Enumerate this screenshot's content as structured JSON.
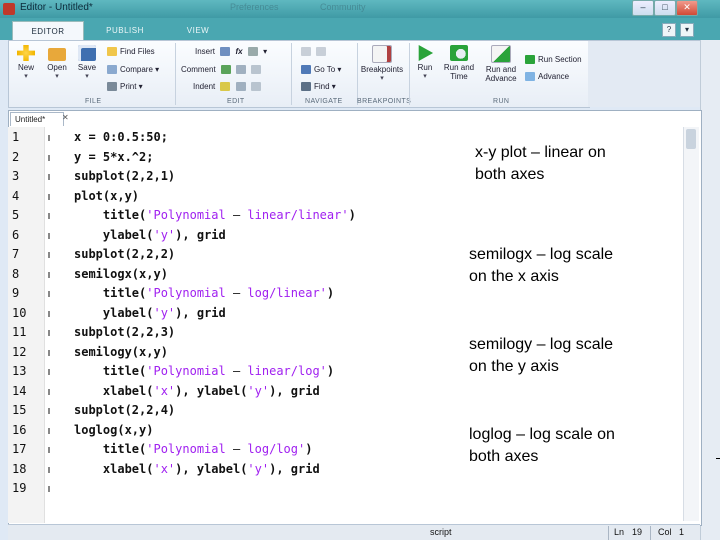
{
  "window": {
    "title": "Editor - Untitled*",
    "ghost_titles": [
      "Preferences",
      "Community"
    ],
    "controls": [
      "–",
      "□",
      "✕"
    ]
  },
  "tabs": [
    {
      "label": "EDITOR",
      "active": true
    },
    {
      "label": "PUBLISH",
      "active": false
    },
    {
      "label": "VIEW",
      "active": false
    }
  ],
  "quick_access": [
    "?",
    "▾"
  ],
  "ribbon": {
    "file": {
      "group_label": "FILE",
      "new": "New",
      "open": "Open",
      "save": "Save",
      "find_files": "Find Files",
      "compare": "Compare",
      "print": "Print"
    },
    "edit": {
      "group_label": "EDIT",
      "insert": "Insert",
      "comment": "Comment",
      "indent": "Indent",
      "fx": "fx"
    },
    "navigate": {
      "group_label": "NAVIGATE",
      "go_to": "Go To",
      "find": "Find"
    },
    "breakpoints": {
      "group_label": "BREAKPOINTS",
      "breakpoints": "Breakpoints"
    },
    "run": {
      "group_label": "RUN",
      "run": "Run",
      "run_and_time": [
        "Run and",
        "Time"
      ],
      "run_and_advance": [
        "Run and",
        "Advance"
      ],
      "run_section": "Run Section",
      "advance": "Advance"
    },
    "colors": {
      "new": "#f2b600",
      "open": "#e8a83a",
      "save": "#3f6fb0",
      "run": "#2aa33a",
      "breakpoints": "#b04040"
    }
  },
  "document_tab": "Untitled*",
  "code_lines": [
    [
      {
        "t": "x = 0:0.5:50;"
      }
    ],
    [
      {
        "t": "y = 5*x.^2;"
      }
    ],
    [
      {
        "t": "subplot(2,2,1)"
      }
    ],
    [
      {
        "t": "plot(x,y)"
      }
    ],
    [
      {
        "t": "    title("
      },
      {
        "t": "'Polynomial",
        "s": 1
      },
      {
        "t": " – ",
        "d": 1
      },
      {
        "t": "linear/linear'",
        "s": 1
      },
      {
        "t": ")"
      }
    ],
    [
      {
        "t": "    ylabel("
      },
      {
        "t": "'y'",
        "s": 1
      },
      {
        "t": "), grid"
      }
    ],
    [
      {
        "t": "subplot(2,2,2)"
      }
    ],
    [
      {
        "t": "semilogx(x,y)"
      }
    ],
    [
      {
        "t": "    title("
      },
      {
        "t": "'Polynomial",
        "s": 1
      },
      {
        "t": " – ",
        "d": 1
      },
      {
        "t": "log/linear'",
        "s": 1
      },
      {
        "t": ")"
      }
    ],
    [
      {
        "t": "    ylabel("
      },
      {
        "t": "'y'",
        "s": 1
      },
      {
        "t": "), grid"
      }
    ],
    [
      {
        "t": "subplot(2,2,3)"
      }
    ],
    [
      {
        "t": "semilogy(x,y)"
      }
    ],
    [
      {
        "t": "    title("
      },
      {
        "t": "'Polynomial",
        "s": 1
      },
      {
        "t": " – ",
        "d": 1
      },
      {
        "t": "linear/log'",
        "s": 1
      },
      {
        "t": ")"
      }
    ],
    [
      {
        "t": "    xlabel("
      },
      {
        "t": "'x'",
        "s": 1
      },
      {
        "t": "), ylabel("
      },
      {
        "t": "'y'",
        "s": 1
      },
      {
        "t": "), grid"
      }
    ],
    [
      {
        "t": "subplot(2,2,4)"
      }
    ],
    [
      {
        "t": "loglog(x,y)"
      }
    ],
    [
      {
        "t": "    title("
      },
      {
        "t": "'Polynomial",
        "s": 1
      },
      {
        "t": " – ",
        "d": 1
      },
      {
        "t": "log/log'",
        "s": 1
      },
      {
        "t": ")"
      }
    ],
    [
      {
        "t": "    xlabel("
      },
      {
        "t": "'x'",
        "s": 1
      },
      {
        "t": "), ylabel("
      },
      {
        "t": "'y'",
        "s": 1
      },
      {
        "t": "), grid"
      }
    ],
    []
  ],
  "string_color": "#a020f0",
  "annotations": [
    "x-y plot – linear on\nboth axes",
    "semilogx – log scale\non the x axis",
    "semilogy – log scale\non the y axis",
    "loglog – log scale on\nboth axes"
  ],
  "status": {
    "mode": "script",
    "ln_label": "Ln",
    "ln_value": "19",
    "col_label": "Col",
    "col_value": "1"
  }
}
